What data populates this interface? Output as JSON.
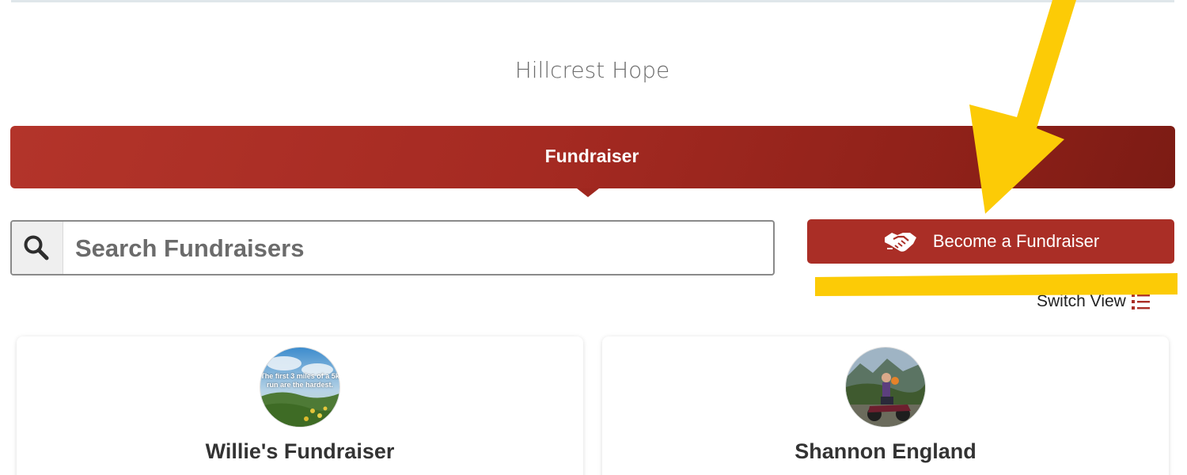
{
  "org": {
    "name": "Hillcrest Hope"
  },
  "tabs": [
    {
      "label": "Fundraiser"
    }
  ],
  "search": {
    "placeholder": "Search Fundraisers",
    "value": ""
  },
  "actions": {
    "become_fundraiser": "Become a Fundraiser",
    "switch_view": "Switch View"
  },
  "fundraisers": [
    {
      "name": "Willie's Fundraiser",
      "avatar_caption": "The first 3 miles of a 5k run are the hardest."
    },
    {
      "name": "Shannon England"
    }
  ],
  "colors": {
    "brand_red": "#aa2e26",
    "annotation_yellow": "#fccb06"
  },
  "icons": {
    "search": "search-icon",
    "handshake": "handshake-icon",
    "list_view": "list-view-icon"
  }
}
